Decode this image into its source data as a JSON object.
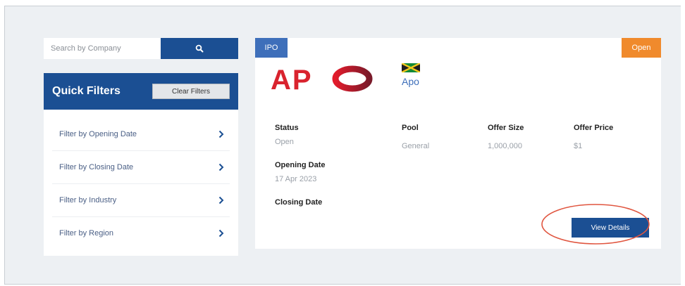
{
  "search": {
    "placeholder": "Search by Company",
    "button_icon": "search-icon"
  },
  "filters": {
    "title": "Quick Filters",
    "clear_label": "Clear Filters",
    "items": [
      {
        "label": "Filter by Opening Date",
        "icon": "chevron-right-icon"
      },
      {
        "label": "Filter by Closing Date",
        "icon": "chevron-right-icon"
      },
      {
        "label": "Filter by Industry",
        "icon": "chevron-right-icon"
      },
      {
        "label": "Filter by Region",
        "icon": "chevron-right-icon"
      }
    ]
  },
  "ipo": {
    "type_badge": "IPO",
    "status_badge": "Open",
    "logo_text": "APO",
    "company_name": "Apo",
    "flag_icon": "jamaica-flag-icon",
    "fields": {
      "status_label": "Status",
      "status_value": "Open",
      "pool_label": "Pool",
      "pool_value": "General",
      "offer_size_label": "Offer Size",
      "offer_size_value": "1,000,000",
      "offer_price_label": "Offer Price",
      "offer_price_value": "$1",
      "opening_date_label": "Opening Date",
      "opening_date_value": "17 Apr 2023",
      "closing_date_label": "Closing Date"
    },
    "view_details_label": "View Details"
  },
  "colors": {
    "brand_blue": "#1b4f93",
    "badge_blue": "#3e6fba",
    "open_orange": "#f08a2c",
    "logo_red": "#d9232e",
    "annotation_red": "#e0553f",
    "background": "#edf0f3"
  }
}
